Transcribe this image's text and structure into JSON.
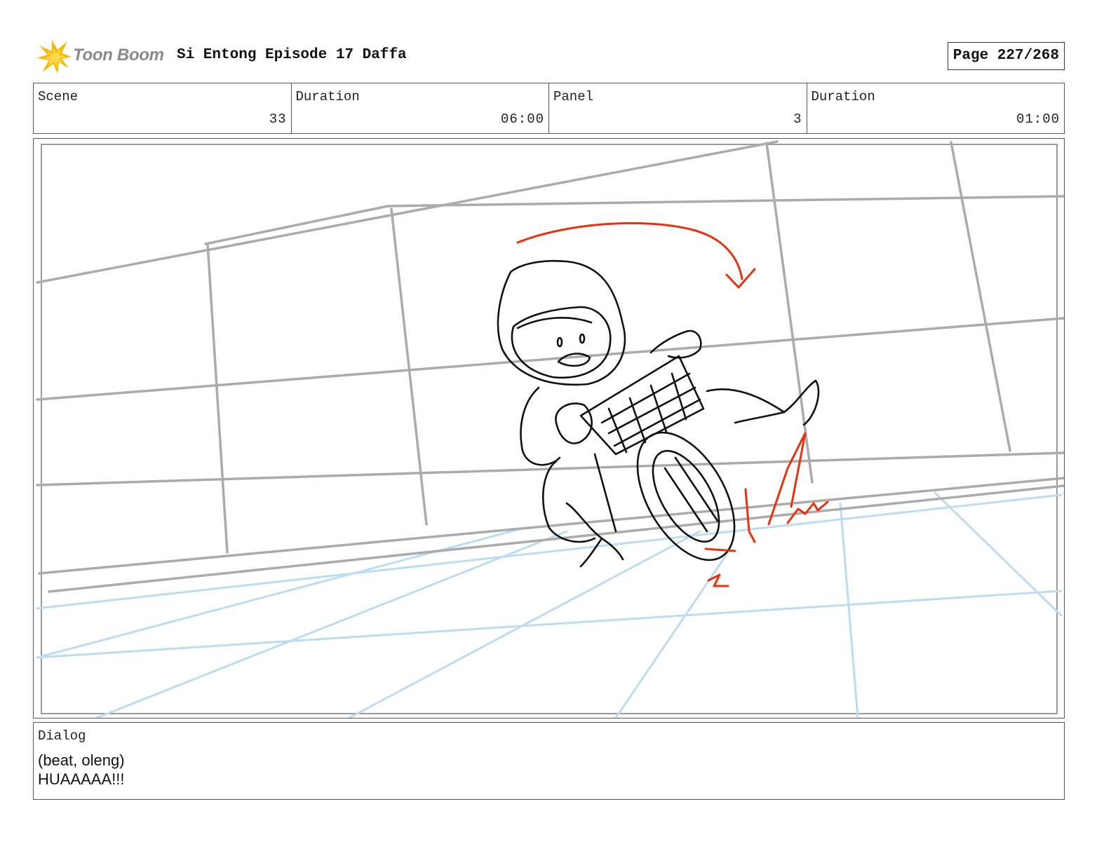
{
  "header": {
    "logo_text": "Toon Boom",
    "title": "Si Entong Episode 17 Daffa",
    "page": "Page 227/268"
  },
  "meta": [
    {
      "label": "Scene",
      "value": "33"
    },
    {
      "label": "Duration",
      "value": "06:00"
    },
    {
      "label": "Panel",
      "value": "3"
    },
    {
      "label": "Duration",
      "value": "01:00"
    }
  ],
  "colors": {
    "sketch": "#111111",
    "wall_lines": "#ababab",
    "floor_lines": "#bcdcf2",
    "action_marks": "#e8320f",
    "logo": "#f5b800"
  },
  "dialog": {
    "label": "Dialog",
    "lines": [
      "(beat, oleng)",
      "HUAAAAA!!!"
    ]
  }
}
